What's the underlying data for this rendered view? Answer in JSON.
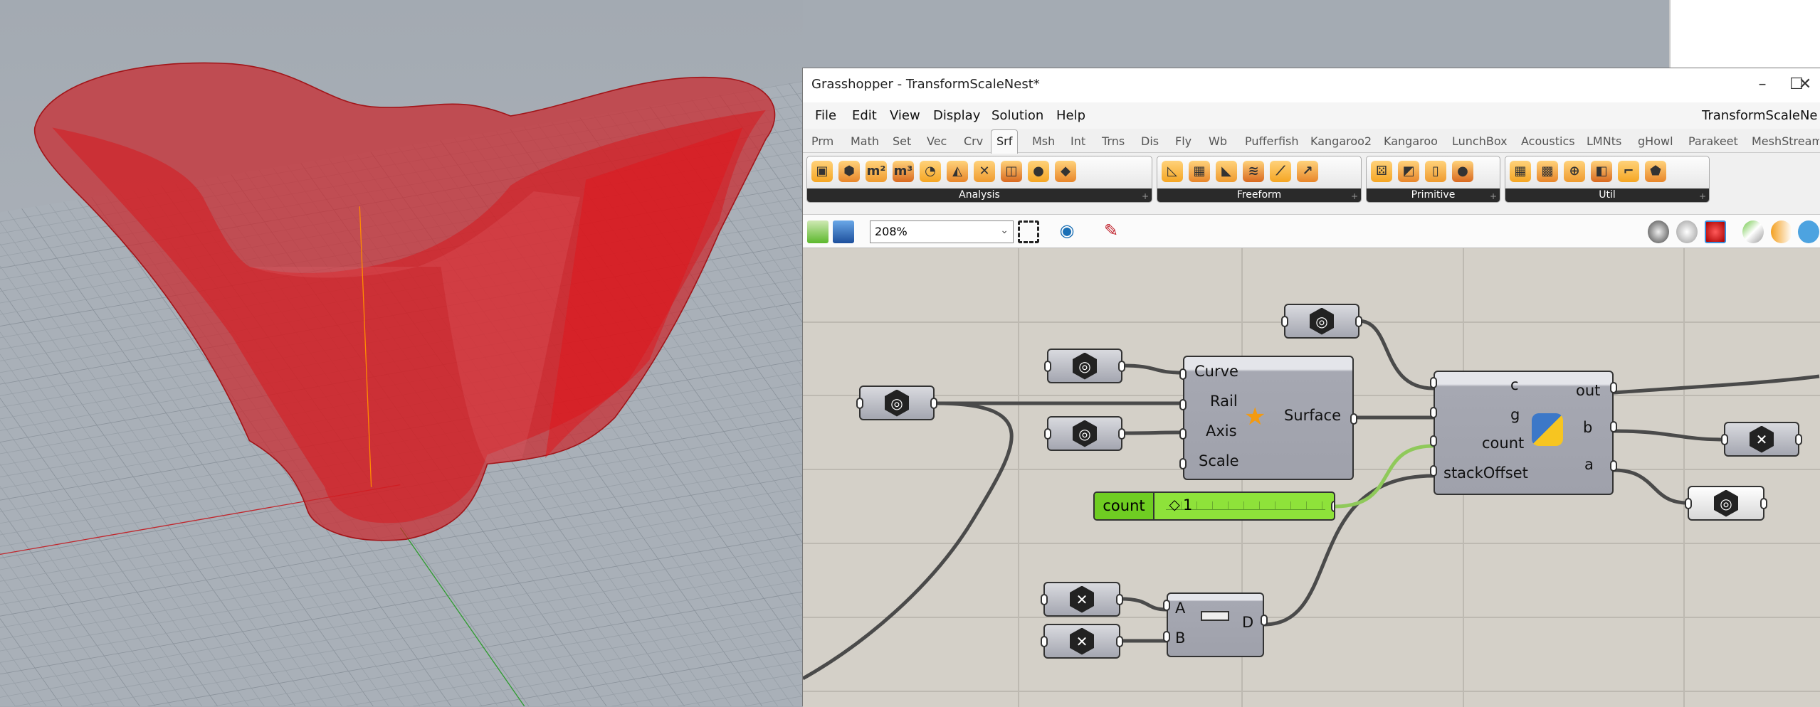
{
  "window": {
    "title": "Grasshopper - TransformScaleNest*",
    "minimize": "–",
    "maximize": "☐",
    "close": "✕"
  },
  "menu": {
    "items": [
      "File",
      "Edit",
      "View",
      "Display",
      "Solution",
      "Help"
    ],
    "document_name": "TransformScaleNe"
  },
  "tabs": {
    "items": [
      "Prm",
      "Math",
      "Set",
      "Vec",
      "Crv",
      "Srf",
      "Msh",
      "Int",
      "Trns",
      "Dis",
      "Fly",
      "Wb",
      "Pufferfish",
      "Kangaroo2",
      "Kangaroo",
      "LunchBox",
      "Acoustics",
      "LMNts",
      "gHowl",
      "Parakeet",
      "MeshStreami"
    ],
    "active": "Srf"
  },
  "ribbon": {
    "groups": [
      {
        "label": "Analysis",
        "icons": [
          {
            "name": "box-icon",
            "glyph": "▣"
          },
          {
            "name": "brep-icon",
            "glyph": "⬢"
          },
          {
            "name": "area-icon",
            "glyph": "m²"
          },
          {
            "name": "volume-icon",
            "glyph": "m³"
          },
          {
            "name": "evaluate-icon",
            "glyph": "◔"
          },
          {
            "name": "deconstruct-icon",
            "glyph": "◭"
          },
          {
            "name": "dimensions-icon",
            "glyph": "✕"
          },
          {
            "name": "closest-point-icon",
            "glyph": "◫"
          },
          {
            "name": "point-on-icon",
            "glyph": "●"
          },
          {
            "name": "shape-icon",
            "glyph": "◆"
          }
        ]
      },
      {
        "label": "Freeform",
        "icons": [
          {
            "name": "boundary-icon",
            "glyph": "◺"
          },
          {
            "name": "network-icon",
            "glyph": "▦"
          },
          {
            "name": "extrude-icon",
            "glyph": "◣"
          },
          {
            "name": "loft-icon",
            "glyph": "≋"
          },
          {
            "name": "pipe-icon",
            "glyph": "⟋"
          },
          {
            "name": "sweep-icon",
            "glyph": "↗"
          }
        ]
      },
      {
        "label": "Primitive",
        "icons": [
          {
            "name": "sphere-points-icon",
            "glyph": "⚄"
          },
          {
            "name": "plane-box-icon",
            "glyph": "◩"
          },
          {
            "name": "cylinder-icon",
            "glyph": "▯"
          },
          {
            "name": "sphere-icon",
            "glyph": "●"
          }
        ]
      },
      {
        "label": "Util",
        "icons": [
          {
            "name": "divide-icon",
            "glyph": "▦"
          },
          {
            "name": "isotrim-icon",
            "glyph": "▩"
          },
          {
            "name": "offset-icon",
            "glyph": "⊕"
          },
          {
            "name": "cap-icon",
            "glyph": "◧"
          },
          {
            "name": "edges-icon",
            "glyph": "⌐"
          },
          {
            "name": "flip-icon",
            "glyph": "⬟"
          }
        ]
      }
    ]
  },
  "toolbar": {
    "zoom": "208%"
  },
  "canvas": {
    "revolve": {
      "inputs": [
        "Curve",
        "Rail",
        "Axis",
        "Scale"
      ],
      "output": "Surface"
    },
    "python": {
      "inputs": [
        "c",
        "g",
        "count",
        "stackOffset"
      ],
      "outputs": [
        "out",
        "b",
        "a"
      ]
    },
    "slider": {
      "name": "count",
      "value": "1",
      "fraction": 0.02
    },
    "distance": {
      "inputs": [
        "A",
        "B"
      ],
      "output": "D"
    }
  },
  "colors": {
    "vase": "#d0161b",
    "slider": "#8ee23a",
    "x_axis": "#c0272d",
    "y_axis": "#2e9b2e",
    "canvas": "#d4d0c8"
  }
}
